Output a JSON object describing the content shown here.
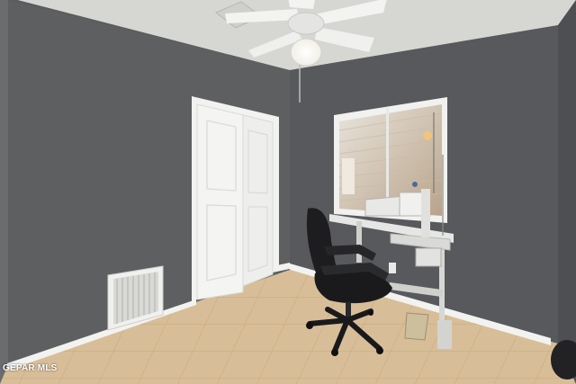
{
  "photo": {
    "description_icons": [
      "ceiling-fan-icon",
      "office-chair-icon",
      "sewing-machine-icon"
    ],
    "colors": {
      "wall_left": "#5d5f61",
      "wall_back": "#5a5c5f",
      "ceiling": "#dcdcda",
      "floor_tile": "#d9c09a",
      "grout": "#c7ab84",
      "trim": "#f2f2f0",
      "door": "#f4f4f2",
      "chair": "#1c1c1e"
    }
  },
  "watermark": {
    "text": "GEPAR MLS"
  }
}
